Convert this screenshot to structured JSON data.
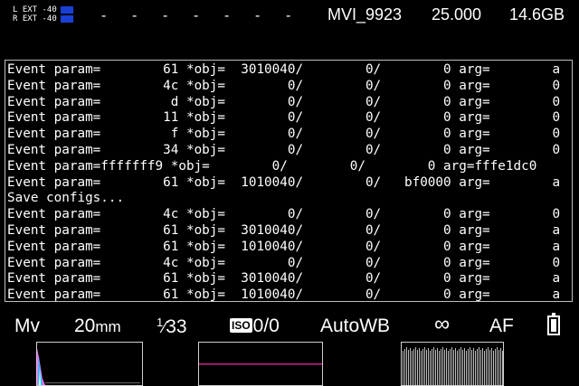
{
  "status_bar": {
    "audio_left_label": "L EXT -40",
    "audio_right_label": "R EXT -40",
    "dashes": [
      "-",
      "-",
      "-",
      "-",
      "-",
      "-",
      "-",
      "-"
    ],
    "clip_name": "MVI_9923",
    "fps": "25.000",
    "card_space": "14.6GB",
    "audio_meter_color": "#1a3fd6"
  },
  "console": {
    "lines": [
      "Event param=        61 *obj=  3010040/        0/        0 arg=        a",
      "Event param=        4c *obj=        0/        0/        0 arg=        0",
      "Event param=         d *obj=        0/        0/        0 arg=        0",
      "Event param=        11 *obj=        0/        0/        0 arg=        0",
      "Event param=         f *obj=        0/        0/        0 arg=        0",
      "Event param=        34 *obj=        0/        0/        0 arg=        0",
      "Event param=fffffff9 *obj=        0/        0/        0 arg=fffe1dc0",
      "Event param=        61 *obj=  1010040/        0/   bf0000 arg=        a",
      "Save configs...",
      "Event param=        4c *obj=        0/        0/        0 arg=        0",
      "Event param=        61 *obj=  3010040/        0/        0 arg=        a",
      "Event param=        61 *obj=  1010040/        0/        0 arg=        a",
      "Event param=        4c *obj=        0/        0/        0 arg=        0",
      "Event param=        61 *obj=  3010040/        0/        0 arg=        a",
      "Event param=        61 *obj=  1010040/        0/        0 arg=        a"
    ]
  },
  "bottom_bar": {
    "mode": "Mv",
    "focal_length_value": "20",
    "focal_length_unit": "mm",
    "shutter_numerator": "1",
    "shutter_denominator": "33",
    "iso_badge": "ISO",
    "iso_value": "0/0",
    "white_balance": "AutoWB",
    "focus_distance": "∞",
    "focus_mode": "AF",
    "battery_icon": "battery-full-icon"
  },
  "histograms": {
    "rgb_colors": [
      "#ff66ff",
      "#00c8ff",
      "#ffffff"
    ],
    "waveform_line_color": "#d0208a"
  }
}
